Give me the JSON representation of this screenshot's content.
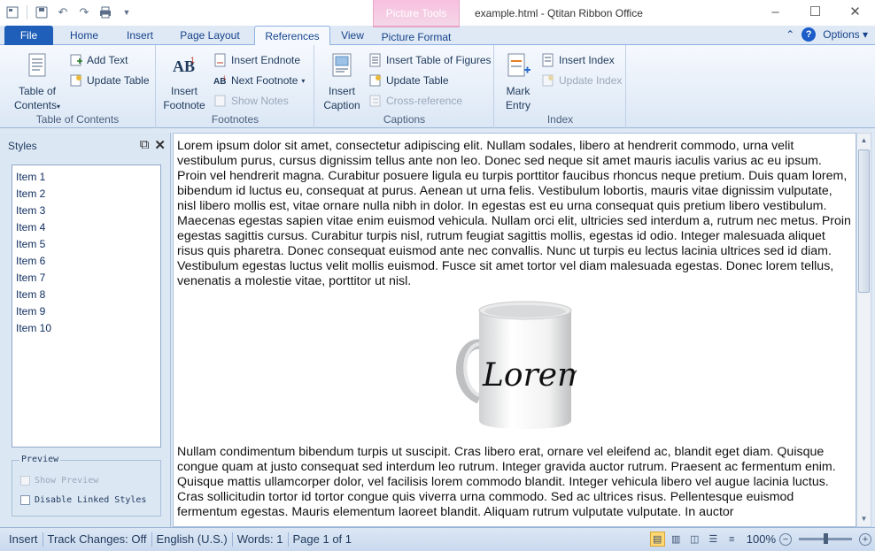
{
  "titlebar": {
    "context_group": "Picture Tools",
    "window_title": "example.html - Qtitan Ribbon Office"
  },
  "tabs": [
    {
      "label": "File"
    },
    {
      "label": "Home"
    },
    {
      "label": "Insert"
    },
    {
      "label": "Page Layout"
    },
    {
      "label": "References"
    },
    {
      "label": "View"
    },
    {
      "label": "Picture Format"
    }
  ],
  "active_tab": "References",
  "tabs_right": {
    "options_label": "Options"
  },
  "ribbon": {
    "toc": {
      "title": "Table of Contents",
      "big_label_1": "Table of",
      "big_label_2": "Contents",
      "add_text": "Add Text",
      "update_table": "Update Table"
    },
    "footnotes": {
      "title": "Footnotes",
      "big_label_1": "Insert",
      "big_label_2": "Footnote",
      "insert_endnote": "Insert Endnote",
      "next_footnote": "Next Footnote",
      "show_notes": "Show Notes"
    },
    "captions": {
      "title": "Captions",
      "big_label_1": "Insert",
      "big_label_2": "Caption",
      "insert_tof": "Insert Table of Figures",
      "update_table": "Update Table",
      "cross_reference": "Cross-reference"
    },
    "index": {
      "title": "Index",
      "big_label_1": "Mark",
      "big_label_2": "Entry",
      "insert_index": "Insert Index",
      "update_index": "Update Index"
    }
  },
  "styles_pane": {
    "title": "Styles",
    "items": [
      "Item 1",
      "Item 2",
      "Item 3",
      "Item 4",
      "Item 5",
      "Item 6",
      "Item 7",
      "Item 8",
      "Item 9",
      "Item 10"
    ],
    "preview_legend": "Preview",
    "show_preview": "Show Preview",
    "disable_linked": "Disable Linked Styles"
  },
  "document": {
    "para1": "Lorem ipsum dolor sit amet, consectetur adipiscing elit. Nullam sodales, libero at hendrerit commodo, urna velit vestibulum purus, cursus dignissim tellus ante non leo. Donec sed neque sit amet mauris iaculis varius ac eu ipsum. Proin vel hendrerit magna. Curabitur posuere ligula eu turpis porttitor faucibus rhoncus neque pretium. Duis quam lorem, bibendum id luctus eu, consequat at purus. Aenean ut urna felis. Vestibulum lobortis, mauris vitae dignissim vulputate, nisl libero mollis est, vitae ornare nulla nibh in dolor. In egestas est eu urna consequat quis pretium libero vestibulum. Maecenas egestas sapien vitae enim euismod vehicula. Nullam orci elit, ultricies sed interdum a, rutrum nec metus. Proin egestas sagittis cursus. Curabitur turpis nisl, rutrum feugiat sagittis mollis, egestas id odio. Integer malesuada aliquet risus quis pharetra. Donec consequat euismod ante nec convallis. Nunc ut turpis eu lectus lacinia ultrices sed id diam. Vestibulum egestas luctus velit mollis euismod. Fusce sit amet tortor vel diam malesuada egestas. Donec lorem tellus, venenatis a molestie vitae, porttitor ut nisl.",
    "mug_text": "Lorem",
    "para2": "Nullam condimentum bibendum turpis ut suscipit. Cras libero erat, ornare vel eleifend ac, blandit eget diam. Quisque congue quam at justo consequat sed interdum leo rutrum. Integer gravida auctor rutrum. Praesent ac fermentum enim. Quisque mattis ullamcorper dolor, vel facilisis lorem commodo blandit. Integer vehicula libero vel augue lacinia luctus. Cras sollicitudin tortor id tortor congue quis viverra urna commodo. Sed ac ultrices risus. Pellentesque euismod fermentum egestas. Mauris elementum laoreet blandit. Aliquam rutrum vulputate vulputate. In auctor"
  },
  "statusbar": {
    "insert": "Insert",
    "track_changes": "Track Changes: Off",
    "language": "English (U.S.)",
    "words": "Words: 1",
    "page": "Page 1 of 1",
    "zoom": "100%"
  }
}
